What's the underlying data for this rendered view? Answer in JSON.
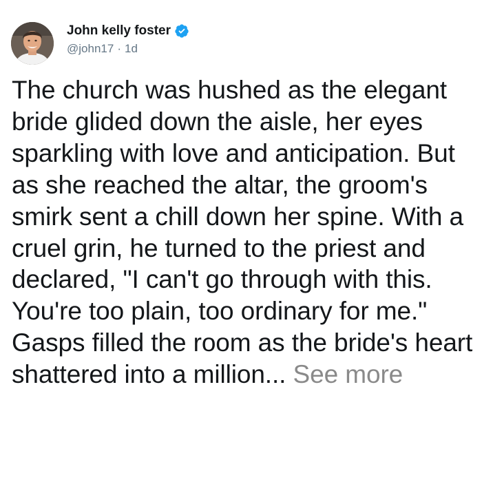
{
  "author": {
    "display_name": "John kelly foster",
    "handle": "@john17",
    "separator": "·",
    "timestamp": "1d",
    "verified": true,
    "verified_icon": "verified-badge-icon"
  },
  "tweet": {
    "text": "The church was hushed as the elegant bride glided down the aisle, her eyes sparkling with love and anticipation. But as she reached the altar, the groom's smirk sent a chill down her spine. With a cruel grin, he turned to the priest and declared, \"I can't go through with this. You're too plain, too ordinary for me.\" Gasps filled the room as the bride's heart shattered into a million...",
    "see_more_label": "See more"
  },
  "colors": {
    "text": "#14171a",
    "secondary": "#657786",
    "verified_blue": "#1da1f2",
    "see_more": "#8a8a8a"
  }
}
